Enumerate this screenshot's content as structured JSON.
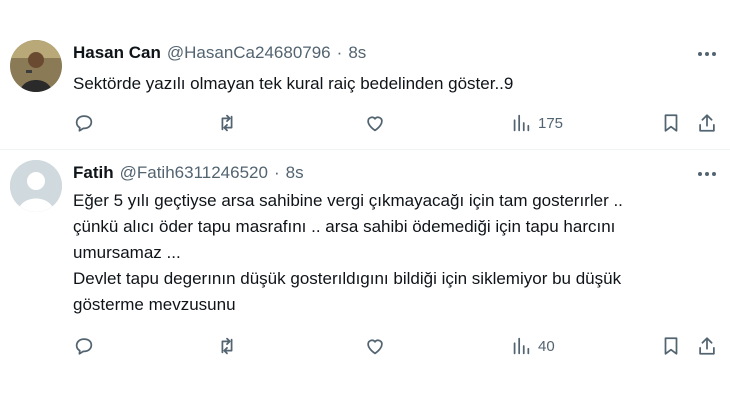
{
  "tweets": [
    {
      "author_name": "Hasan Can",
      "handle": "@HasanCa24680796",
      "separator": "·",
      "time": "8s",
      "lines": [
        "Sektörde yazılı olmayan tek kural raiç bedelinden göster..9"
      ],
      "views": "175",
      "avatar": "photo-avatar"
    },
    {
      "author_name": "Fatih",
      "handle": "@Fatih6311246520",
      "separator": "·",
      "time": "8s",
      "lines": [
        "Eğer 5 yılı geçtiyse arsa sahibine vergi çıkmayacağı için tam gosterırler ..",
        "çünkü alıcı öder tapu masrafını .. arsa sahibi ödemediği için tapu harcını",
        "umursamaz ...",
        "Devlet tapu degerının düşük gosterıldıgını bildiği için siklemiyor bu düşük",
        "gösterme mevzusunu"
      ],
      "views": "40",
      "avatar": "default-avatar"
    }
  ],
  "colors": {
    "text": "#0f1419",
    "muted": "#536471",
    "divider": "#eff3f4",
    "default_avatar": "#cfd9de"
  },
  "icons": [
    "reply-icon",
    "retweet-icon",
    "like-icon",
    "views-icon",
    "bookmark-icon",
    "share-icon",
    "more-icon"
  ]
}
